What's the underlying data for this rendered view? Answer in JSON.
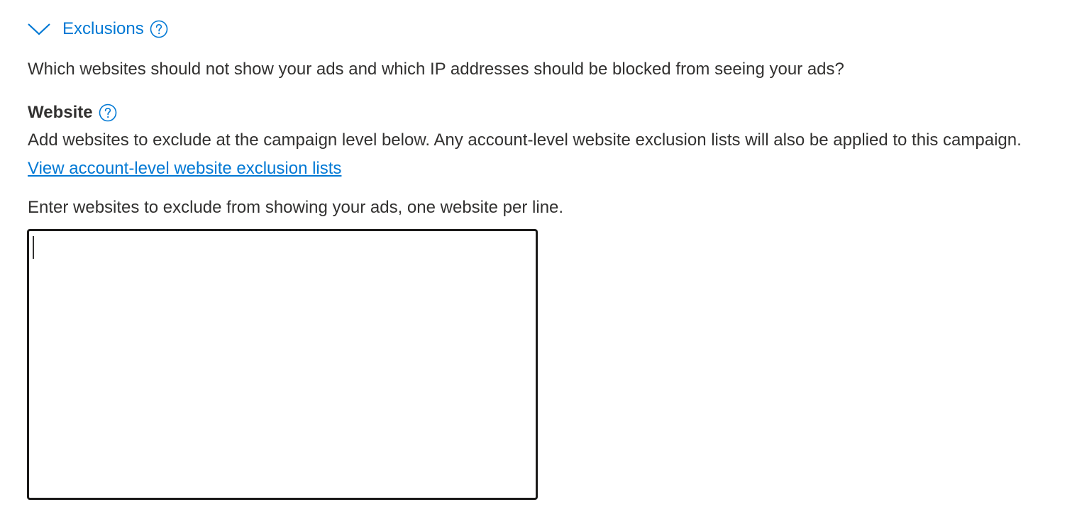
{
  "exclusions": {
    "title": "Exclusions",
    "expanded": true,
    "chevron_icon": "chevron-down-icon",
    "help_icon": "help-circle-icon",
    "description": "Which websites should not show your ads and which IP addresses should be blocked from seeing your ads?"
  },
  "website": {
    "label": "Website",
    "help_icon": "help-circle-icon",
    "help_text": "Add websites to exclude at the campaign level below. Any account-level website exclusion lists will also be applied to this campaign.",
    "link_text": "View account-level website exclusion lists",
    "instruction": "Enter websites to exclude from showing your ads, one website per line.",
    "textarea_value": ""
  },
  "colors": {
    "accent": "#0078d4",
    "text": "#323130",
    "textarea_border": "#1b1a19"
  }
}
